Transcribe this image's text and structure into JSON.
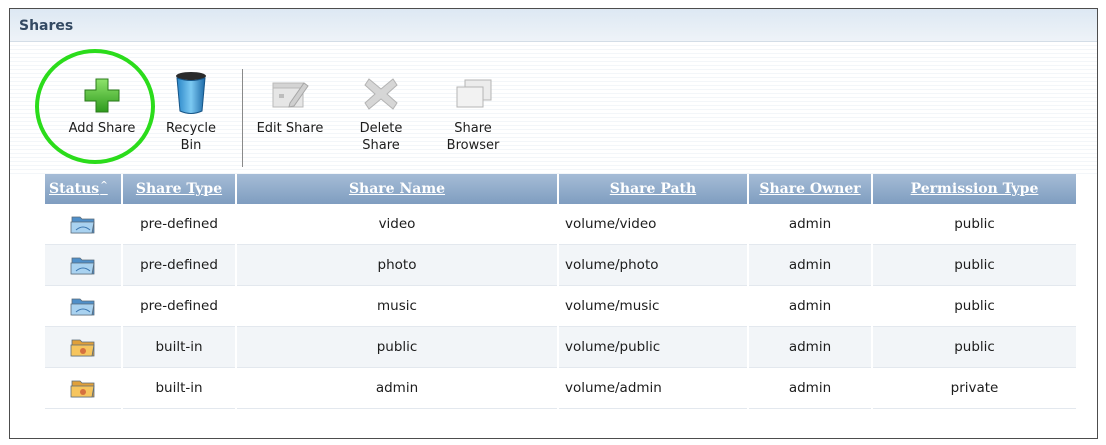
{
  "panel": {
    "title": "Shares"
  },
  "toolbar": {
    "add_share": "Add Share",
    "recycle_bin_line1": "Recycle",
    "recycle_bin_line2": "Bin",
    "edit_share": "Edit Share",
    "delete_share_line1": "Delete",
    "delete_share_line2": "Share",
    "share_browser_line1": "Share",
    "share_browser_line2": "Browser"
  },
  "table": {
    "headers": {
      "status": "Status",
      "share_type": "Share Type",
      "share_name": "Share Name",
      "share_path": "Share Path",
      "share_owner": "Share Owner",
      "permission_type": "Permission Type"
    },
    "sort_indicator": "^",
    "rows": [
      {
        "status_icon": "folder-blue-icon",
        "share_type": "pre-defined",
        "share_name": "video",
        "share_path": "volume/video",
        "share_owner": "admin",
        "permission_type": "public"
      },
      {
        "status_icon": "folder-blue-icon",
        "share_type": "pre-defined",
        "share_name": "photo",
        "share_path": "volume/photo",
        "share_owner": "admin",
        "permission_type": "public"
      },
      {
        "status_icon": "folder-blue-icon",
        "share_type": "pre-defined",
        "share_name": "music",
        "share_path": "volume/music",
        "share_owner": "admin",
        "permission_type": "public"
      },
      {
        "status_icon": "folder-orange-icon",
        "share_type": "built-in",
        "share_name": "public",
        "share_path": "volume/public",
        "share_owner": "admin",
        "permission_type": "public"
      },
      {
        "status_icon": "folder-orange-icon",
        "share_type": "built-in",
        "share_name": "admin",
        "share_path": "volume/admin",
        "share_owner": "admin",
        "permission_type": "private"
      }
    ]
  },
  "colors": {
    "header_bg": "#8fabcc",
    "highlight_circle": "#2bdc1b",
    "title_text": "#344a63"
  }
}
